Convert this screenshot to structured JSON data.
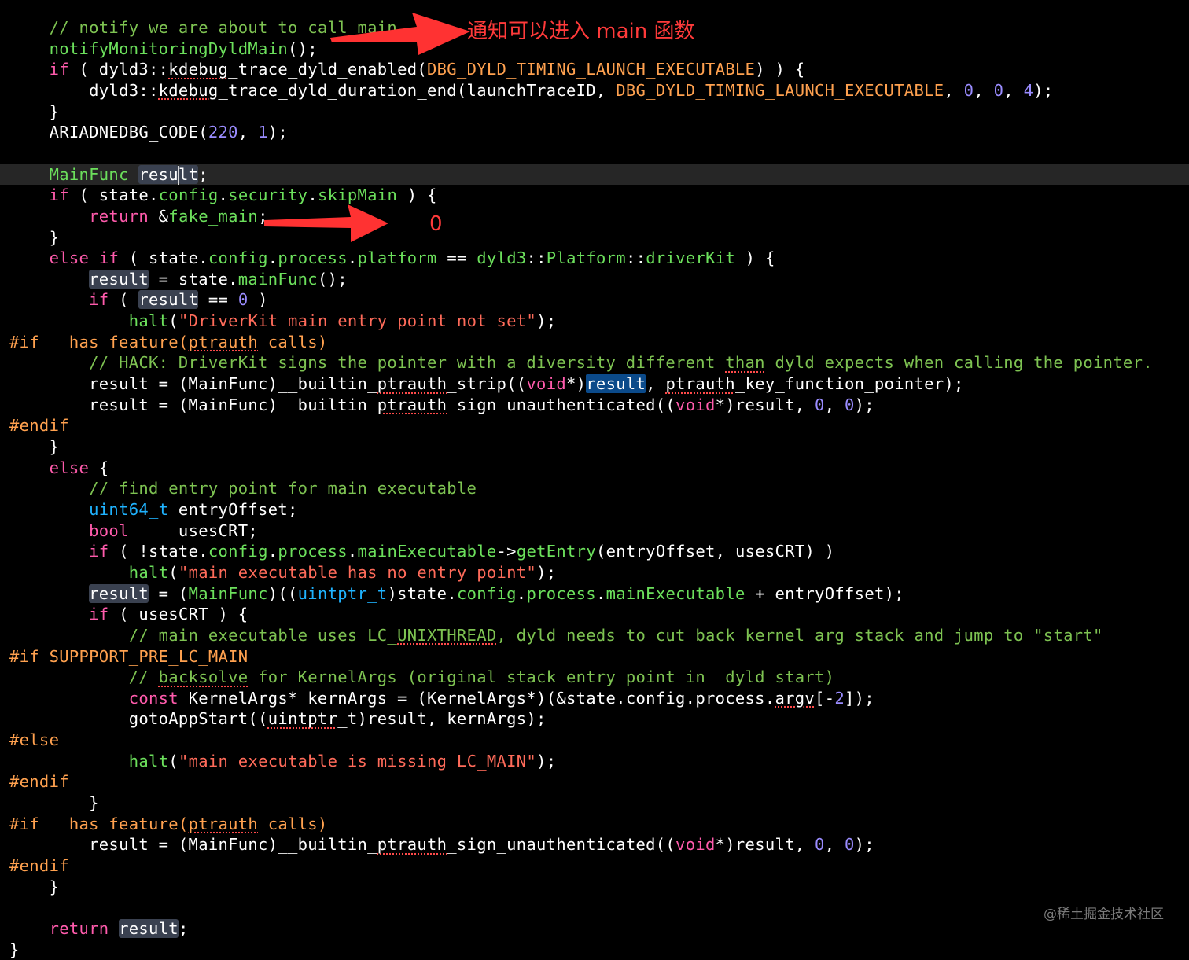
{
  "annotations": {
    "note_main": "通知可以进入 main 函数",
    "note_zero": "0",
    "arrow_1": "red-arrow-icon",
    "arrow_2": "red-arrow-icon"
  },
  "watermark": "@稀土掘金技术社区",
  "colors": {
    "background": "#000000",
    "comment": "#7ec352",
    "keyword": "#ff5bac",
    "type": "#1fb3ff",
    "function": "#6ce05c",
    "macro": "#ffa14f",
    "number": "#9a8cff",
    "string": "#ff6b5a",
    "annotation": "#ff3a3a"
  },
  "code_lines": [
    {
      "indent": "    ",
      "current": false,
      "tokens": [
        {
          "t": "// notify we are about to call main",
          "c": "comment"
        }
      ]
    },
    {
      "indent": "    ",
      "current": false,
      "tokens": [
        {
          "t": "notifyMonitoringDyldMain",
          "c": "func"
        },
        {
          "t": "();",
          "c": "plain"
        }
      ]
    },
    {
      "indent": "    ",
      "current": false,
      "tokens": [
        {
          "t": "if",
          "c": "keyword"
        },
        {
          "t": " ( dyld3::",
          "c": "plain"
        },
        {
          "t": "kdebug",
          "c": "plain",
          "w": true
        },
        {
          "t": "_trace_dyld_enabled(",
          "c": "plain"
        },
        {
          "t": "DBG_DYLD_TIMING_LAUNCH_EXECUTABLE",
          "c": "macro"
        },
        {
          "t": ") ) {",
          "c": "plain"
        }
      ]
    },
    {
      "indent": "        ",
      "current": false,
      "tokens": [
        {
          "t": "dyld3::",
          "c": "plain"
        },
        {
          "t": "kdebug",
          "c": "plain",
          "w": true
        },
        {
          "t": "_trace_dyld_duration_end(launchTraceID, ",
          "c": "plain"
        },
        {
          "t": "DBG_DYLD_TIMING_LAUNCH_EXECUTABLE",
          "c": "macro"
        },
        {
          "t": ", ",
          "c": "plain"
        },
        {
          "t": "0",
          "c": "number"
        },
        {
          "t": ", ",
          "c": "plain"
        },
        {
          "t": "0",
          "c": "number"
        },
        {
          "t": ", ",
          "c": "plain"
        },
        {
          "t": "4",
          "c": "number"
        },
        {
          "t": ");",
          "c": "plain"
        }
      ]
    },
    {
      "indent": "    ",
      "current": false,
      "tokens": [
        {
          "t": "}",
          "c": "plain"
        }
      ]
    },
    {
      "indent": "    ",
      "current": false,
      "tokens": [
        {
          "t": "ARIADNEDBG_CODE(",
          "c": "plain"
        },
        {
          "t": "220",
          "c": "number"
        },
        {
          "t": ", ",
          "c": "plain"
        },
        {
          "t": "1",
          "c": "number"
        },
        {
          "t": ");",
          "c": "plain"
        }
      ]
    },
    {
      "indent": "",
      "current": false,
      "tokens": []
    },
    {
      "indent": "    ",
      "current": true,
      "tokens": [
        {
          "t": "MainFunc",
          "c": "func"
        },
        {
          "t": " ",
          "c": "plain"
        },
        {
          "t": "resu",
          "c": "plain",
          "h": "hl"
        },
        {
          "t": "",
          "c": "plain",
          "caret": true
        },
        {
          "t": "lt",
          "c": "plain",
          "h": "hl"
        },
        {
          "t": ";",
          "c": "plain"
        }
      ]
    },
    {
      "indent": "    ",
      "current": false,
      "tokens": [
        {
          "t": "if",
          "c": "keyword"
        },
        {
          "t": " ( state.",
          "c": "plain"
        },
        {
          "t": "config",
          "c": "member"
        },
        {
          "t": ".",
          "c": "plain"
        },
        {
          "t": "security",
          "c": "member"
        },
        {
          "t": ".",
          "c": "plain"
        },
        {
          "t": "skipMain",
          "c": "member"
        },
        {
          "t": " ) {",
          "c": "plain"
        }
      ]
    },
    {
      "indent": "        ",
      "current": false,
      "tokens": [
        {
          "t": "return",
          "c": "keyword"
        },
        {
          "t": " &",
          "c": "plain"
        },
        {
          "t": "fake_main",
          "c": "func"
        },
        {
          "t": ";",
          "c": "plain"
        }
      ]
    },
    {
      "indent": "    ",
      "current": false,
      "tokens": [
        {
          "t": "}",
          "c": "plain"
        }
      ]
    },
    {
      "indent": "    ",
      "current": false,
      "tokens": [
        {
          "t": "else",
          "c": "keyword"
        },
        {
          "t": " ",
          "c": "plain"
        },
        {
          "t": "if",
          "c": "keyword"
        },
        {
          "t": " ( state.",
          "c": "plain"
        },
        {
          "t": "config",
          "c": "member"
        },
        {
          "t": ".",
          "c": "plain"
        },
        {
          "t": "process",
          "c": "member"
        },
        {
          "t": ".",
          "c": "plain"
        },
        {
          "t": "platform",
          "c": "member"
        },
        {
          "t": " == ",
          "c": "plain"
        },
        {
          "t": "dyld3",
          "c": "func"
        },
        {
          "t": "::",
          "c": "plain"
        },
        {
          "t": "Platform",
          "c": "func"
        },
        {
          "t": "::",
          "c": "plain"
        },
        {
          "t": "driverKit",
          "c": "func"
        },
        {
          "t": " ) {",
          "c": "plain"
        }
      ]
    },
    {
      "indent": "        ",
      "current": false,
      "tokens": [
        {
          "t": "result",
          "c": "plain",
          "h": "hl"
        },
        {
          "t": " = state.",
          "c": "plain"
        },
        {
          "t": "mainFunc",
          "c": "member"
        },
        {
          "t": "();",
          "c": "plain"
        }
      ]
    },
    {
      "indent": "        ",
      "current": false,
      "tokens": [
        {
          "t": "if",
          "c": "keyword"
        },
        {
          "t": " ( ",
          "c": "plain"
        },
        {
          "t": "result",
          "c": "plain",
          "h": "hl"
        },
        {
          "t": " == ",
          "c": "plain"
        },
        {
          "t": "0",
          "c": "number"
        },
        {
          "t": " )",
          "c": "plain"
        }
      ]
    },
    {
      "indent": "            ",
      "current": false,
      "tokens": [
        {
          "t": "halt",
          "c": "func"
        },
        {
          "t": "(",
          "c": "plain"
        },
        {
          "t": "\"DriverKit main entry point not set\"",
          "c": "string"
        },
        {
          "t": ");",
          "c": "plain"
        }
      ]
    },
    {
      "indent": "",
      "current": false,
      "tokens": [
        {
          "t": "#if __has_feature(",
          "c": "preproc"
        },
        {
          "t": "ptrauth",
          "c": "preproc",
          "w": true
        },
        {
          "t": "_calls)",
          "c": "preproc"
        }
      ]
    },
    {
      "indent": "        ",
      "current": false,
      "tokens": [
        {
          "t": "// HACK: DriverKit signs the pointer with a diversity different ",
          "c": "comment"
        },
        {
          "t": "than",
          "c": "comment",
          "w": true
        },
        {
          "t": " dyld expects when calling the pointer.",
          "c": "comment"
        }
      ]
    },
    {
      "indent": "        ",
      "current": false,
      "tokens": [
        {
          "t": "result = (MainFunc)__builtin_",
          "c": "plain"
        },
        {
          "t": "ptrauth",
          "c": "plain",
          "w": true
        },
        {
          "t": "_strip((",
          "c": "plain"
        },
        {
          "t": "void",
          "c": "keyword"
        },
        {
          "t": "*)",
          "c": "plain"
        },
        {
          "t": "result",
          "c": "plain",
          "h": "sel"
        },
        {
          "t": ", ",
          "c": "plain"
        },
        {
          "t": "ptrauth",
          "c": "plain",
          "w": true
        },
        {
          "t": "_key_function_pointer);",
          "c": "plain"
        }
      ]
    },
    {
      "indent": "        ",
      "current": false,
      "tokens": [
        {
          "t": "result = (MainFunc)__builtin_",
          "c": "plain"
        },
        {
          "t": "ptrauth",
          "c": "plain",
          "w": true
        },
        {
          "t": "_sign_unauthenticated((",
          "c": "plain"
        },
        {
          "t": "void",
          "c": "keyword"
        },
        {
          "t": "*)result, ",
          "c": "plain"
        },
        {
          "t": "0",
          "c": "number"
        },
        {
          "t": ", ",
          "c": "plain"
        },
        {
          "t": "0",
          "c": "number"
        },
        {
          "t": ");",
          "c": "plain"
        }
      ]
    },
    {
      "indent": "",
      "current": false,
      "tokens": [
        {
          "t": "#endif",
          "c": "preproc"
        }
      ]
    },
    {
      "indent": "    ",
      "current": false,
      "tokens": [
        {
          "t": "}",
          "c": "plain"
        }
      ]
    },
    {
      "indent": "    ",
      "current": false,
      "tokens": [
        {
          "t": "else",
          "c": "keyword"
        },
        {
          "t": " {",
          "c": "plain"
        }
      ]
    },
    {
      "indent": "        ",
      "current": false,
      "tokens": [
        {
          "t": "// find entry point for main executable",
          "c": "comment"
        }
      ]
    },
    {
      "indent": "        ",
      "current": false,
      "tokens": [
        {
          "t": "uint64_t",
          "c": "type"
        },
        {
          "t": " entryOffset;",
          "c": "plain"
        }
      ]
    },
    {
      "indent": "        ",
      "current": false,
      "tokens": [
        {
          "t": "bool",
          "c": "keyword"
        },
        {
          "t": "     usesCRT;",
          "c": "plain"
        }
      ]
    },
    {
      "indent": "        ",
      "current": false,
      "tokens": [
        {
          "t": "if",
          "c": "keyword"
        },
        {
          "t": " ( !state.",
          "c": "plain"
        },
        {
          "t": "config",
          "c": "member"
        },
        {
          "t": ".",
          "c": "plain"
        },
        {
          "t": "process",
          "c": "member"
        },
        {
          "t": ".",
          "c": "plain"
        },
        {
          "t": "mainExecutable",
          "c": "member"
        },
        {
          "t": "->",
          "c": "plain"
        },
        {
          "t": "getEntry",
          "c": "func"
        },
        {
          "t": "(entryOffset, usesCRT) )",
          "c": "plain"
        }
      ]
    },
    {
      "indent": "            ",
      "current": false,
      "tokens": [
        {
          "t": "halt",
          "c": "func"
        },
        {
          "t": "(",
          "c": "plain"
        },
        {
          "t": "\"main executable has no entry point\"",
          "c": "string"
        },
        {
          "t": ");",
          "c": "plain"
        }
      ]
    },
    {
      "indent": "        ",
      "current": false,
      "tokens": [
        {
          "t": "result",
          "c": "plain",
          "h": "hl"
        },
        {
          "t": " = (",
          "c": "plain"
        },
        {
          "t": "MainFunc",
          "c": "func"
        },
        {
          "t": ")((",
          "c": "plain"
        },
        {
          "t": "uintptr_t",
          "c": "type"
        },
        {
          "t": ")state.",
          "c": "plain"
        },
        {
          "t": "config",
          "c": "member"
        },
        {
          "t": ".",
          "c": "plain"
        },
        {
          "t": "process",
          "c": "member"
        },
        {
          "t": ".",
          "c": "plain"
        },
        {
          "t": "mainExecutable",
          "c": "member"
        },
        {
          "t": " + entryOffset);",
          "c": "plain"
        }
      ]
    },
    {
      "indent": "        ",
      "current": false,
      "tokens": [
        {
          "t": "if",
          "c": "keyword"
        },
        {
          "t": " ( usesCRT ) {",
          "c": "plain"
        }
      ]
    },
    {
      "indent": "            ",
      "current": false,
      "tokens": [
        {
          "t": "// main executable uses LC_",
          "c": "comment"
        },
        {
          "t": "UNIXTHREAD",
          "c": "comment",
          "w": true
        },
        {
          "t": ", dyld needs to cut back kernel arg stack and jump to \"start\"",
          "c": "comment"
        }
      ]
    },
    {
      "indent": "",
      "current": false,
      "tokens": [
        {
          "t": "#if SUPPPORT_PRE_LC_MAIN",
          "c": "preproc"
        }
      ]
    },
    {
      "indent": "            ",
      "current": false,
      "tokens": [
        {
          "t": "// ",
          "c": "comment"
        },
        {
          "t": "backsolve",
          "c": "comment",
          "w": true
        },
        {
          "t": " for KernelArgs (original stack entry point in _dyld_start)",
          "c": "comment"
        }
      ]
    },
    {
      "indent": "            ",
      "current": false,
      "tokens": [
        {
          "t": "const",
          "c": "keyword"
        },
        {
          "t": " KernelArgs* kernArgs = (KernelArgs*)(&state.config.process.",
          "c": "plain"
        },
        {
          "t": "argv",
          "c": "plain",
          "w": true
        },
        {
          "t": "[-",
          "c": "plain"
        },
        {
          "t": "2",
          "c": "number"
        },
        {
          "t": "]);",
          "c": "plain"
        }
      ]
    },
    {
      "indent": "            ",
      "current": false,
      "tokens": [
        {
          "t": "gotoAppStart((",
          "c": "plain"
        },
        {
          "t": "uintptr",
          "c": "plain",
          "w": true
        },
        {
          "t": "_t)result, kernArgs);",
          "c": "plain"
        }
      ]
    },
    {
      "indent": "",
      "current": false,
      "tokens": [
        {
          "t": "#else",
          "c": "preproc"
        }
      ]
    },
    {
      "indent": "            ",
      "current": false,
      "tokens": [
        {
          "t": "halt",
          "c": "func"
        },
        {
          "t": "(",
          "c": "plain"
        },
        {
          "t": "\"main executable is missing LC_MAIN\"",
          "c": "string"
        },
        {
          "t": ");",
          "c": "plain"
        }
      ]
    },
    {
      "indent": "",
      "current": false,
      "tokens": [
        {
          "t": "#endif",
          "c": "preproc"
        }
      ]
    },
    {
      "indent": "        ",
      "current": false,
      "tokens": [
        {
          "t": "}",
          "c": "plain"
        }
      ]
    },
    {
      "indent": "",
      "current": false,
      "tokens": [
        {
          "t": "#if __has_feature(",
          "c": "preproc"
        },
        {
          "t": "ptrauth",
          "c": "preproc",
          "w": true
        },
        {
          "t": "_calls)",
          "c": "preproc"
        }
      ]
    },
    {
      "indent": "        ",
      "current": false,
      "tokens": [
        {
          "t": "result = (MainFunc)__builtin_",
          "c": "plain"
        },
        {
          "t": "ptrauth",
          "c": "plain",
          "w": true
        },
        {
          "t": "_sign_unauthenticated((",
          "c": "plain"
        },
        {
          "t": "void",
          "c": "keyword"
        },
        {
          "t": "*)result, ",
          "c": "plain"
        },
        {
          "t": "0",
          "c": "number"
        },
        {
          "t": ", ",
          "c": "plain"
        },
        {
          "t": "0",
          "c": "number"
        },
        {
          "t": ");",
          "c": "plain"
        }
      ]
    },
    {
      "indent": "",
      "current": false,
      "tokens": [
        {
          "t": "#endif",
          "c": "preproc"
        }
      ]
    },
    {
      "indent": "    ",
      "current": false,
      "tokens": [
        {
          "t": "}",
          "c": "plain"
        }
      ]
    },
    {
      "indent": "",
      "current": false,
      "tokens": []
    },
    {
      "indent": "    ",
      "current": false,
      "tokens": [
        {
          "t": "return",
          "c": "keyword"
        },
        {
          "t": " ",
          "c": "plain"
        },
        {
          "t": "result",
          "c": "plain",
          "h": "hl"
        },
        {
          "t": ";",
          "c": "plain"
        }
      ]
    },
    {
      "indent": "",
      "current": false,
      "tokens": [
        {
          "t": "}",
          "c": "plain"
        }
      ]
    }
  ]
}
